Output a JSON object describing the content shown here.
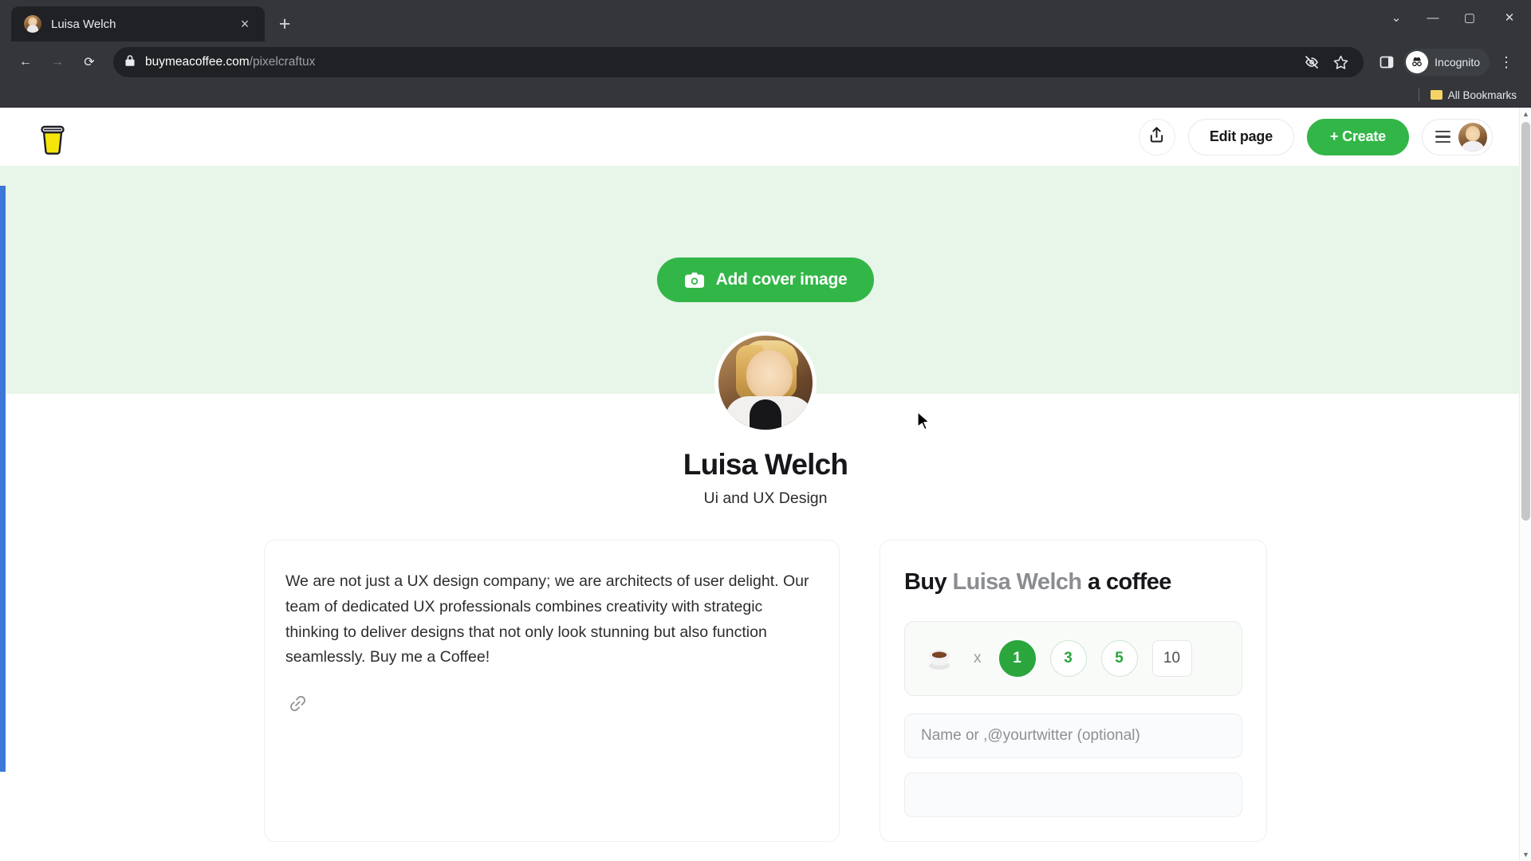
{
  "browser": {
    "tab": {
      "title": "Luisa Welch",
      "favicon": "profile-photo-favicon",
      "close": "×"
    },
    "new_tab": "+",
    "window": {
      "minimize": "—",
      "maximize": "▢",
      "close": "✕",
      "restore_caret": "⌄"
    },
    "nav": {
      "back": "←",
      "forward": "→",
      "reload": "⟳"
    },
    "omnibox": {
      "lock_icon": "lock-icon",
      "domain": "buymeacoffee.com",
      "path": "/pixelcraftux",
      "icons": [
        "eye-off-icon",
        "star-icon"
      ]
    },
    "side_panel": "side-panel-icon",
    "profile": {
      "label": "Incognito",
      "icon": "incognito-icon"
    },
    "menu": "⋮",
    "bookmarks": {
      "label": "All Bookmarks",
      "icon": "folder-icon"
    }
  },
  "site": {
    "logo": "buymeacoffee-cup-logo",
    "header": {
      "share_icon": "share-icon",
      "edit_page_label": "Edit page",
      "create_label": "+ Create",
      "menu_icon": "hamburger-icon",
      "avatar": "user-avatar"
    },
    "cover": {
      "add_cover_label": "Add cover image",
      "camera_icon": "camera-icon",
      "background_color": "#e8f5e9"
    },
    "profile": {
      "name": "Luisa Welch",
      "tagline": "Ui and UX Design",
      "avatar": "profile-avatar"
    },
    "bio": {
      "text": "We are not just a UX design company; we are architects of user delight. Our team of dedicated UX professionals combines creativity with strategic thinking to deliver designs that not only look stunning but also function seamlessly. Buy me a Coffee!",
      "link_icon": "link-icon"
    },
    "buy": {
      "title_prefix": "Buy",
      "title_name": "Luisa Welch",
      "title_suffix": "a coffee",
      "coffee_icon": "coffee-cup-icon",
      "multiplier": "x",
      "quantities": [
        "1",
        "3",
        "5"
      ],
      "selected_quantity": "1",
      "custom_quantity": "10",
      "name_placeholder": "Name or ,@yourtwitter (optional)",
      "message_placeholder": ""
    },
    "accent_color": "#33b648",
    "quantity_accent": "#2aa63d"
  },
  "scrollbar": {
    "up": "▲",
    "down": "▼"
  }
}
